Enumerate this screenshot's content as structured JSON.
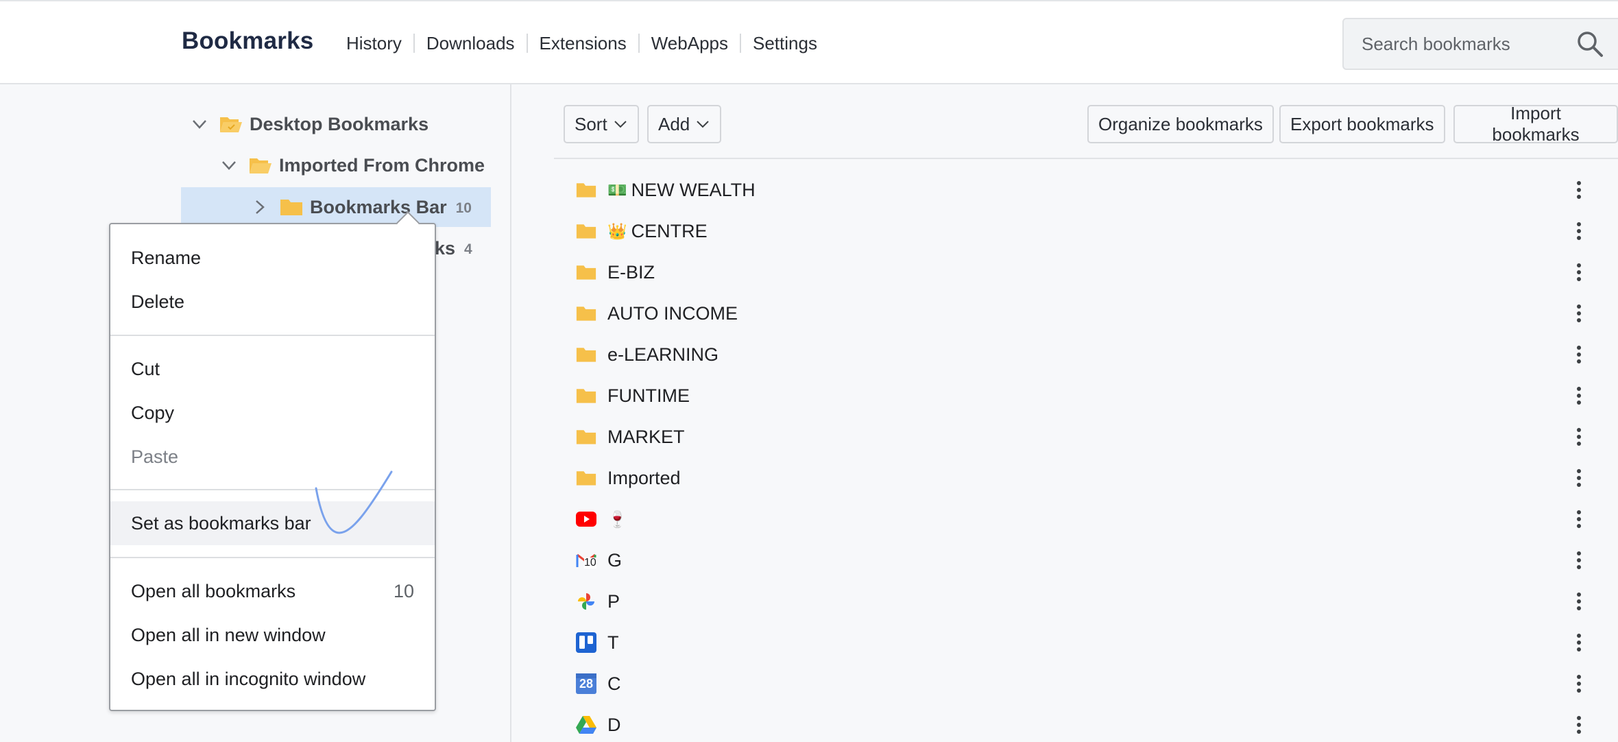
{
  "header": {
    "title": "Bookmarks",
    "nav": [
      "History",
      "Downloads",
      "Extensions",
      "WebApps",
      "Settings"
    ],
    "search_placeholder": "Search bookmarks"
  },
  "sidebar": {
    "tree": [
      {
        "label": "Desktop Bookmarks",
        "expanded": true
      },
      {
        "label": "Imported From Chrome",
        "expanded": true
      },
      {
        "label": "Bookmarks Bar",
        "count": "10",
        "selected": true
      },
      {
        "label_fragment": "ks",
        "count": "4"
      }
    ]
  },
  "context_menu": {
    "rename": "Rename",
    "delete": "Delete",
    "cut": "Cut",
    "copy": "Copy",
    "paste": "Paste",
    "set_as_bookmarks_bar": "Set as bookmarks bar",
    "open_all": "Open all bookmarks",
    "open_all_count": "10",
    "open_all_new_window": "Open all in new window",
    "open_all_incognito": "Open all in incognito window"
  },
  "toolbar": {
    "sort": "Sort",
    "add": "Add",
    "organize": "Organize bookmarks",
    "export": "Export bookmarks",
    "import": "Import bookmarks"
  },
  "bookmarks": [
    {
      "emoji": "💵",
      "label": "NEW WEALTH",
      "icon": "folder-icon"
    },
    {
      "emoji": "👑",
      "label": "CENTRE",
      "icon": "folder-icon"
    },
    {
      "label": "E-BIZ",
      "icon": "folder-icon"
    },
    {
      "label": "AUTO INCOME",
      "icon": "folder-icon"
    },
    {
      "label": "e-LEARNING",
      "icon": "folder-icon"
    },
    {
      "label": "FUNTIME",
      "icon": "folder-icon"
    },
    {
      "label": "MARKET",
      "icon": "folder-icon"
    },
    {
      "label": "Imported",
      "icon": "folder-icon"
    },
    {
      "emoji": "🍷",
      "label": "",
      "icon": "youtube-icon"
    },
    {
      "label": "G",
      "icon": "gmail-icon",
      "badge": "10"
    },
    {
      "label": "P",
      "icon": "google-photos-icon"
    },
    {
      "label": "T",
      "icon": "trello-icon"
    },
    {
      "label": "C",
      "icon": "google-calendar-icon",
      "badge": "28"
    },
    {
      "label": "D",
      "icon": "google-drive-icon"
    }
  ],
  "colors": {
    "folder": "#f6c04a",
    "selected_bg": "#d5e5f7",
    "scribble": "#7aa2ec"
  }
}
